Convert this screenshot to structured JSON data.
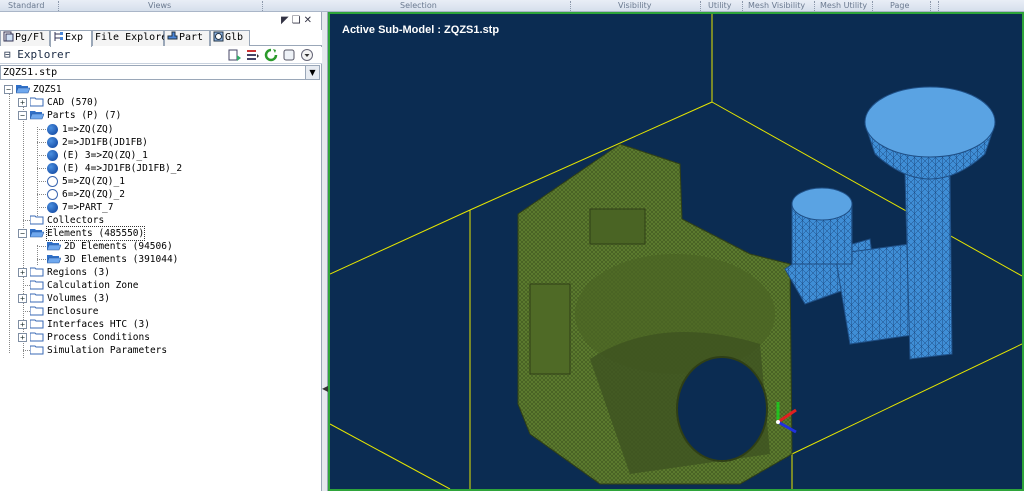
{
  "toolbar": {
    "sections": [
      "Standard",
      "Views",
      "Selection",
      "Visibility",
      "Utility",
      "Mesh Visibility",
      "Mesh Utility",
      "Page"
    ]
  },
  "panel": {
    "tabs": [
      {
        "label": "Pg/Fl",
        "icon": "page-icon"
      },
      {
        "label": "Exp",
        "icon": "explorer-icon"
      },
      {
        "label": "File Explorer",
        "icon": ""
      },
      {
        "label": "Part",
        "icon": "part-icon"
      },
      {
        "label": "Glb",
        "icon": "globe-icon"
      }
    ],
    "explorer_title": "Explorer",
    "model_select": "ZQZS1.stp"
  },
  "tree": {
    "root": "ZQZS1",
    "cad": "CAD (570)",
    "parts": "Parts (P) (7)",
    "part_items": [
      {
        "label": "1=>ZQ(ZQ)",
        "filled": true
      },
      {
        "label": "2=>JD1FB(JD1FB)",
        "filled": true
      },
      {
        "label": "(E) 3=>ZQ(ZQ)_1",
        "filled": true
      },
      {
        "label": "(E) 4=>JD1FB(JD1FB)_2",
        "filled": true
      },
      {
        "label": "5=>ZQ(ZQ)_1",
        "filled": false
      },
      {
        "label": "6=>ZQ(ZQ)_2",
        "filled": false
      },
      {
        "label": "7=>PART_7",
        "filled": true
      }
    ],
    "collectors": "Collectors",
    "elements": "Elements (485550)",
    "elements_2d": "2D Elements (94506)",
    "elements_3d": "3D Elements (391044)",
    "regions": "Regions (3)",
    "calc_zone": "Calculation Zone",
    "volumes": "Volumes (3)",
    "enclosure": "Enclosure",
    "interfaces": "Interfaces HTC (3)",
    "process_conditions": "Process Conditions",
    "simulation_parameters": "Simulation Parameters"
  },
  "viewport": {
    "active_label": "Active Sub-Model : ZQZS1.stp",
    "colors": {
      "background": "#0b2c52",
      "border": "#2ea43a",
      "box_lines": "#e6e600",
      "casting_mesh": "#5b7a2e",
      "riser_mesh": "#3f8ed6"
    }
  }
}
